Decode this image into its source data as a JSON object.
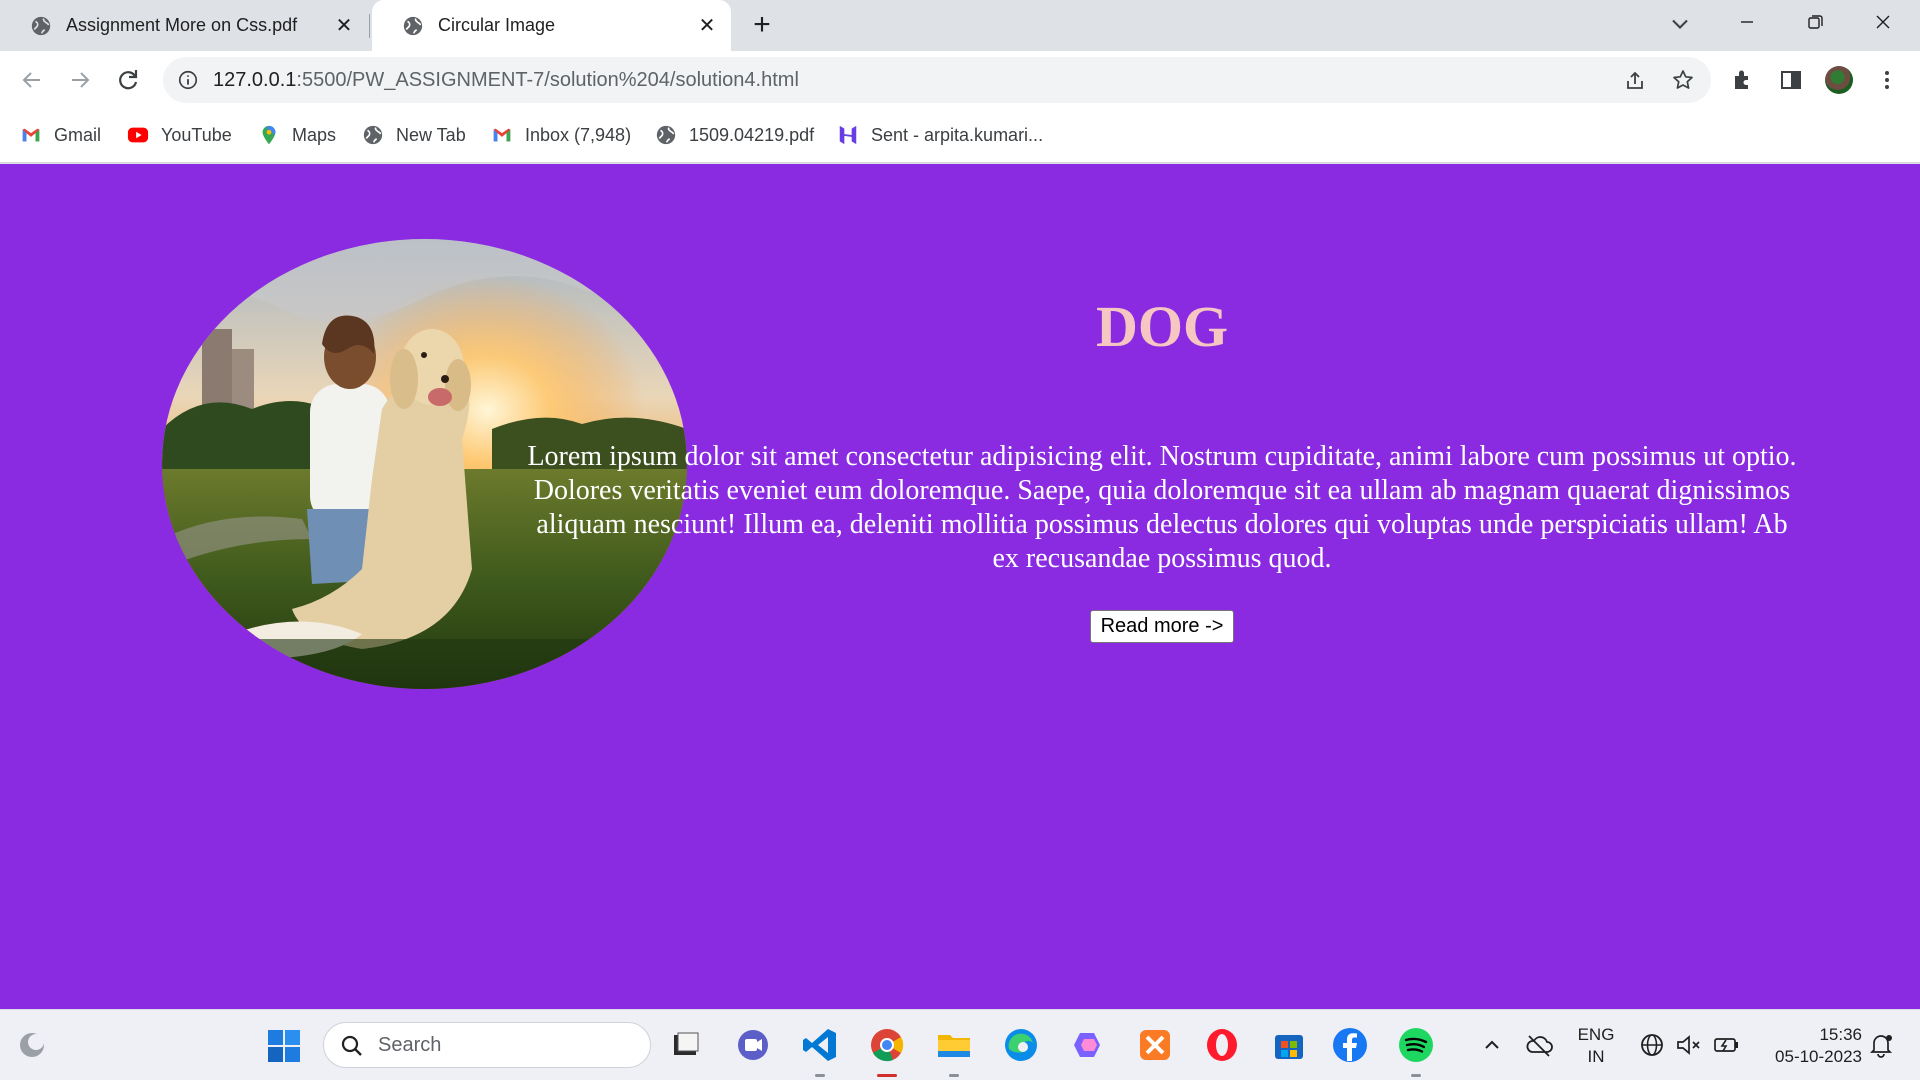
{
  "browser": {
    "tabs": [
      {
        "title": "Assignment More on Css.pdf",
        "active": false
      },
      {
        "title": "Circular Image",
        "active": true
      }
    ],
    "tab_close_glyph": "✕",
    "new_tab_glyph": "+",
    "address": {
      "host": "127.0.0.1",
      "rest": ":5500/PW_ASSIGNMENT-7/solution%204/solution4.html"
    },
    "bookmarks": [
      {
        "label": "Gmail",
        "icon": "gmail-icon"
      },
      {
        "label": "YouTube",
        "icon": "youtube-icon"
      },
      {
        "label": "Maps",
        "icon": "maps-icon"
      },
      {
        "label": "New Tab",
        "icon": "globe-icon"
      },
      {
        "label": "Inbox (7,948)",
        "icon": "gmail-icon"
      },
      {
        "label": "1509.04219.pdf",
        "icon": "globe-icon"
      },
      {
        "label": "Sent - arpita.kumari...",
        "icon": "hostinger-icon"
      }
    ]
  },
  "page": {
    "background": "#8a2be2",
    "heading": "DOG",
    "heading_color": "#f5c6c2",
    "paragraph": "Lorem ipsum dolor sit amet consectetur adipisicing elit. Nostrum cupiditate, animi labore cum possimus ut optio. Dolores veritatis eveniet eum doloremque. Saepe, quia doloremque sit ea ullam ab magnam quaerat dignissimos aliquam nesciunt! Illum ea, deleniti mollitia possimus delectus dolores qui voluptas unde perspiciatis ullam! Ab ex recusandae possimus quod.",
    "button": "Read more ->",
    "image_subject": "girl hugging golden retriever in a field at sunset"
  },
  "taskbar": {
    "search_placeholder": "Search",
    "apps": [
      "file-explorer-icon",
      "teams-icon",
      "vscode-icon",
      "chrome-icon",
      "folder-icon",
      "edge-icon",
      "copilot-icon",
      "xampp-icon",
      "opera-icon",
      "store-icon",
      "facebook-icon",
      "spotify-icon"
    ],
    "language": "ENG",
    "region": "IN",
    "time": "15:36",
    "date": "05-10-2023"
  }
}
